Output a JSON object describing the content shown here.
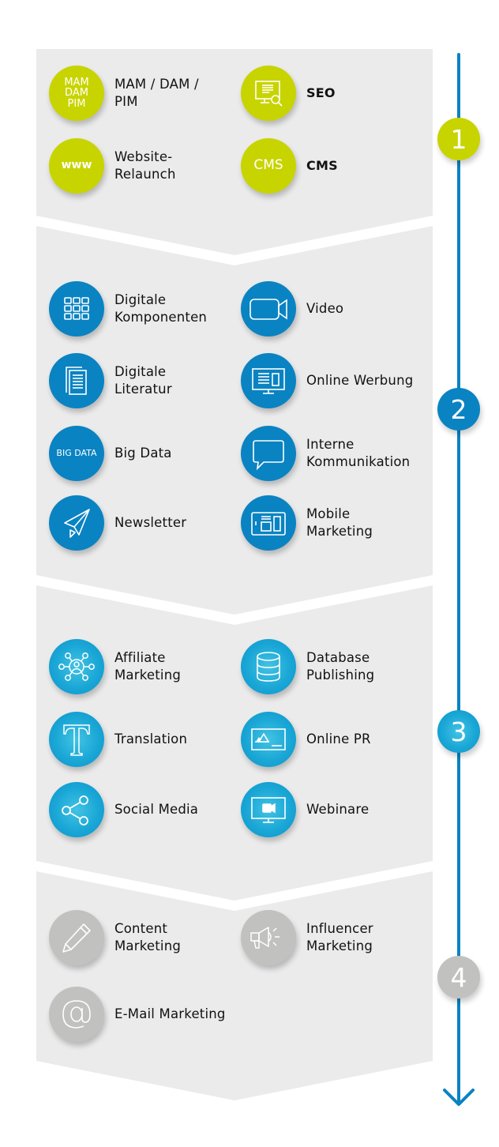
{
  "colors": {
    "panel": "#ebebeb",
    "timeline": "#0a83c2",
    "stage1": "#c8d400",
    "stage2": "#0a83c2",
    "stage3": "#1aa7d6",
    "stage4": "#c1c1bf"
  },
  "stages": [
    {
      "badge": "1",
      "items": [
        {
          "label": "MAM / DAM / PIM",
          "label_lines": [
            "MAM / DAM /",
            "PIM"
          ],
          "icon": "mam-dam-pim-text-icon",
          "icon_text": [
            "MAM",
            "DAM",
            "PIM"
          ]
        },
        {
          "label": "SEO",
          "label_lines": [
            "SEO"
          ],
          "icon": "monitor-search-icon"
        },
        {
          "label": "Website-Relaunch",
          "label_lines": [
            "Website-",
            "Relaunch"
          ],
          "icon": "www-text-icon",
          "icon_text": [
            "www"
          ]
        },
        {
          "label": "CMS",
          "label_lines": [
            "CMS"
          ],
          "icon": "cms-text-icon",
          "icon_text": [
            "CMS"
          ]
        }
      ]
    },
    {
      "badge": "2",
      "items": [
        {
          "label": "Digitale Komponenten",
          "label_lines": [
            "Digitale",
            "Komponenten"
          ],
          "icon": "grid-icon"
        },
        {
          "label": "Video",
          "label_lines": [
            "Video"
          ],
          "icon": "video-camera-icon"
        },
        {
          "label": "Digitale Literatur",
          "label_lines": [
            "Digitale",
            "Literatur"
          ],
          "icon": "documents-icon"
        },
        {
          "label": "Online Werbung",
          "label_lines": [
            "Online Werbung"
          ],
          "icon": "monitor-ad-icon"
        },
        {
          "label": "Big Data",
          "label_lines": [
            "Big Data"
          ],
          "icon": "big-data-text-icon",
          "icon_text": [
            "BIG DATA"
          ]
        },
        {
          "label": "Interne Kommunikation",
          "label_lines": [
            "Interne",
            "Kommunikation"
          ],
          "icon": "speech-bubble-icon"
        },
        {
          "label": "Newsletter",
          "label_lines": [
            "Newsletter"
          ],
          "icon": "paper-plane-icon"
        },
        {
          "label": "Mobile Marketing",
          "label_lines": [
            "Mobile",
            "Marketing"
          ],
          "icon": "tablet-icon"
        }
      ]
    },
    {
      "badge": "3",
      "items": [
        {
          "label": "Affiliate Marketing",
          "label_lines": [
            "Affiliate",
            "Marketing"
          ],
          "icon": "network-person-icon"
        },
        {
          "label": "Database Publishing",
          "label_lines": [
            "Database",
            "Publishing"
          ],
          "icon": "database-icon"
        },
        {
          "label": "Translation",
          "label_lines": [
            "Translation"
          ],
          "icon": "letter-t-icon"
        },
        {
          "label": "Online PR",
          "label_lines": [
            "Online PR"
          ],
          "icon": "image-card-icon"
        },
        {
          "label": "Social Media",
          "label_lines": [
            "Social Media"
          ],
          "icon": "share-icon"
        },
        {
          "label": "Webinare",
          "label_lines": [
            "Webinare"
          ],
          "icon": "monitor-video-icon"
        }
      ]
    },
    {
      "badge": "4",
      "items": [
        {
          "label": "Content Marketing",
          "label_lines": [
            "Content",
            "Marketing"
          ],
          "icon": "pencil-icon"
        },
        {
          "label": "Influencer Marketing",
          "label_lines": [
            "Influencer",
            "Marketing"
          ],
          "icon": "megaphone-icon"
        },
        {
          "label": "E-Mail Marketing",
          "label_lines": [
            "E-Mail Marketing"
          ],
          "icon": "at-sign-icon"
        }
      ]
    }
  ]
}
